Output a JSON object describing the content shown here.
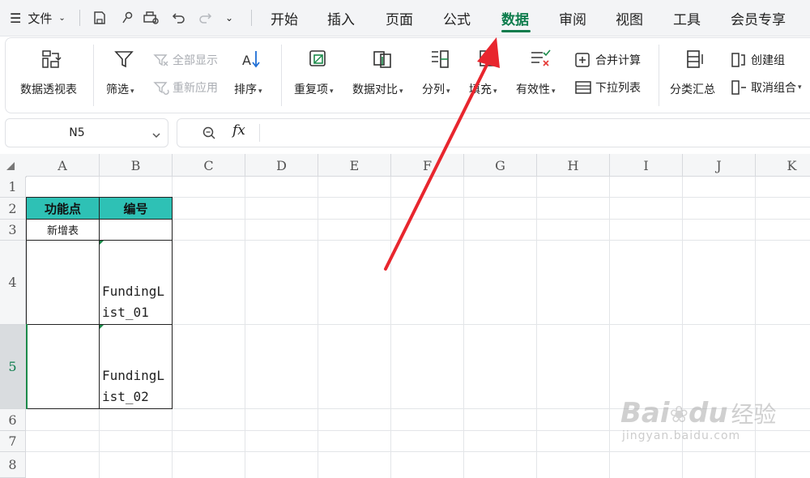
{
  "menubar": {
    "file_label": "文件",
    "tabs": [
      "开始",
      "插入",
      "页面",
      "公式",
      "数据",
      "审阅",
      "视图",
      "工具",
      "会员专享"
    ],
    "active_tab": "数据"
  },
  "ribbon": {
    "pivot_table": "数据透视表",
    "filter": "筛选",
    "show_all": "全部显示",
    "reapply": "重新应用",
    "sort": "排序",
    "duplicates": "重复项",
    "data_compare": "数据对比",
    "split_column": "分列",
    "fill": "填充",
    "validity": "有效性",
    "merge_calc": "合并计算",
    "dropdown_list": "下拉列表",
    "subtotal": "分类汇总",
    "create_group": "创建组",
    "ungroup": "取消组合"
  },
  "formula_bar": {
    "name_box": "N5",
    "fx_label": "fx",
    "content": ""
  },
  "grid": {
    "columns": [
      "A",
      "B",
      "C",
      "D",
      "E",
      "F",
      "G",
      "H",
      "I",
      "J",
      "K"
    ],
    "rows": [
      "1",
      "2",
      "3",
      "4",
      "5",
      "6",
      "7",
      "8"
    ],
    "cells": {
      "A2": "功能点",
      "B2": "编号",
      "A3": "新增表",
      "B4_line1": "FundingL",
      "B4_line2": "ist_01",
      "B5_line1": "FundingL",
      "B5_line2": "ist_02"
    }
  },
  "watermark": {
    "brand": "Bai",
    "brand2": "du",
    "suffix": "经验",
    "url": "jingyan.baidu.com"
  },
  "colors": {
    "accent": "#0d7c4c",
    "header_fill": "#2ec1b5",
    "arrow": "#e8262e"
  }
}
